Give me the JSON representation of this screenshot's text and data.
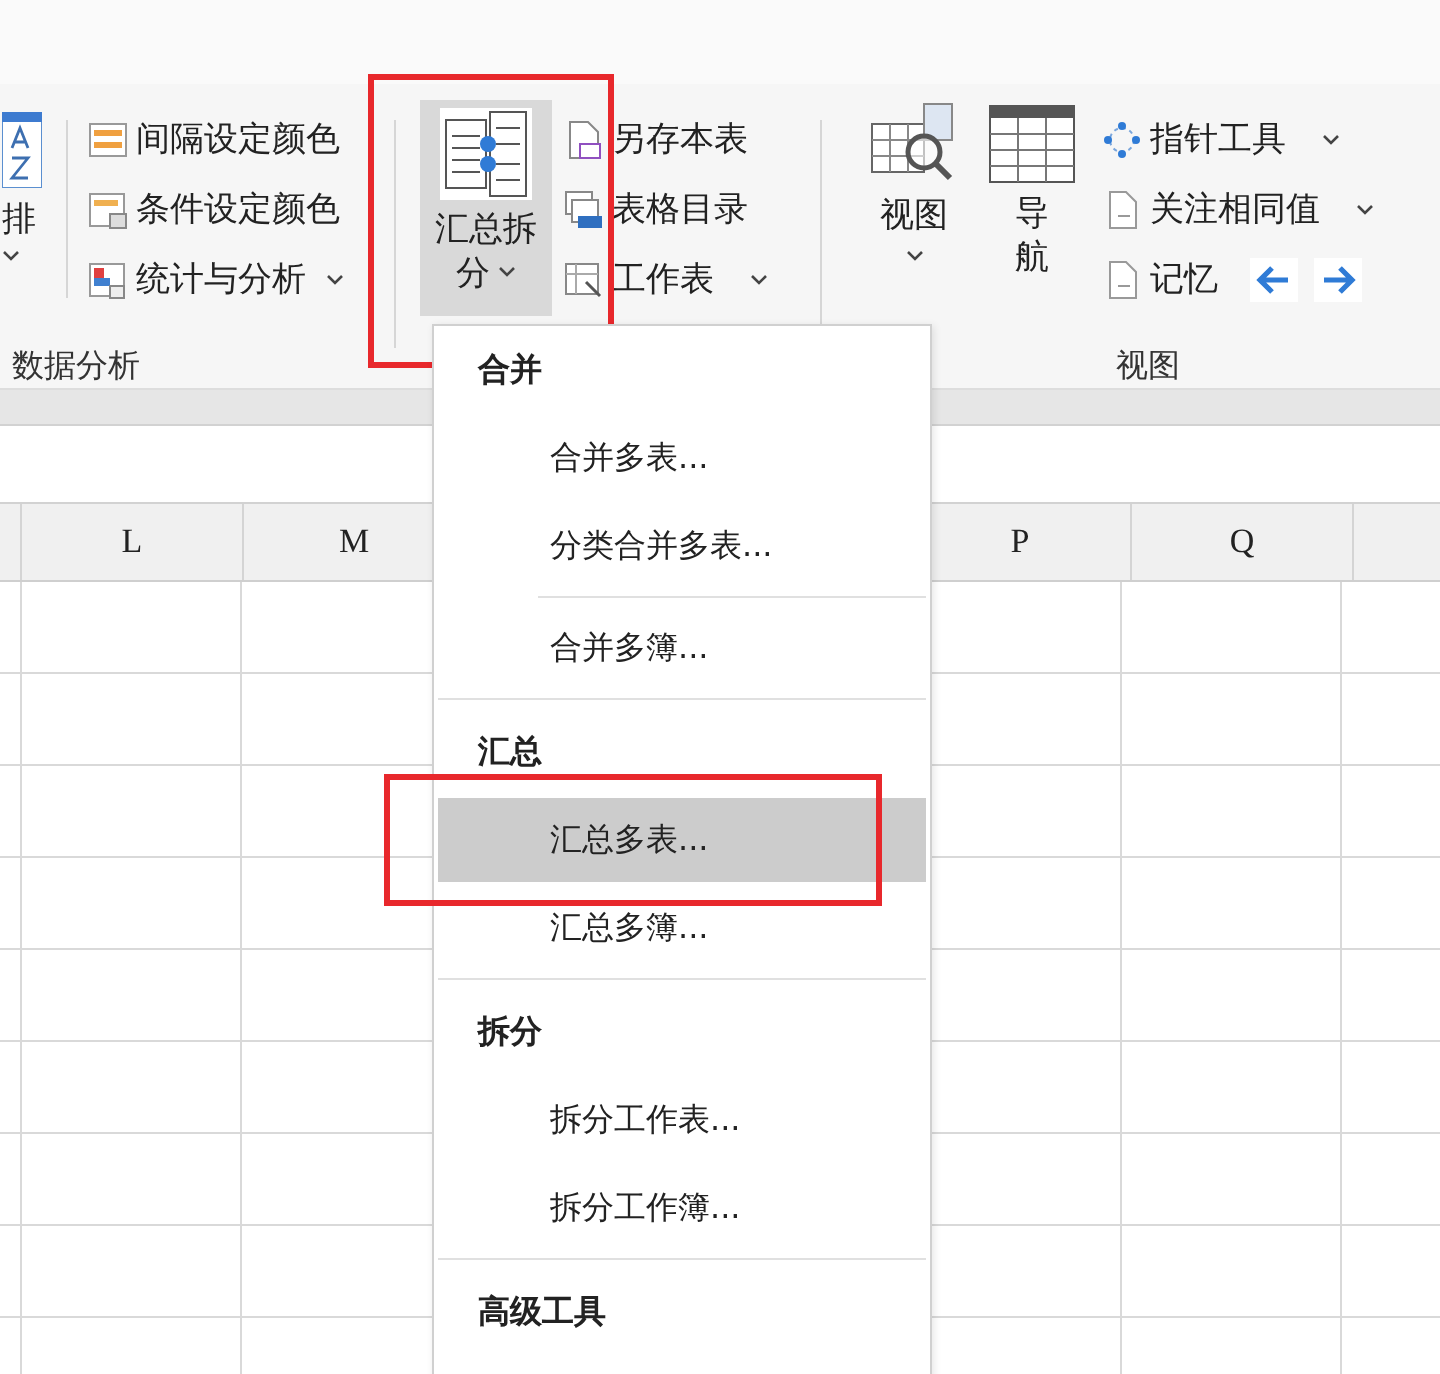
{
  "ribbon": {
    "sort_button": {
      "label": "排",
      "dropdown": true
    },
    "analysis_group": {
      "label": "数据分析",
      "items": [
        {
          "label": "间隔设定颜色",
          "dropdown": false
        },
        {
          "label": "条件设定颜色",
          "dropdown": false
        },
        {
          "label": "统计与分析",
          "dropdown": true
        }
      ]
    },
    "split_group": {
      "big_button": {
        "label": "汇总拆分",
        "pressed": true,
        "highlighted": true,
        "dropdown": true
      },
      "items": [
        {
          "label": "另存本表",
          "dropdown": false
        },
        {
          "label": "表格目录",
          "dropdown": false
        },
        {
          "label": "工作表",
          "dropdown": true
        }
      ]
    },
    "view_group": {
      "label": "视图",
      "view_button": {
        "label": "视图",
        "dropdown": true
      },
      "nav_button": {
        "label": "导航"
      },
      "items": [
        {
          "label": "指针工具",
          "dropdown": true
        },
        {
          "label": "关注相同值",
          "dropdown": true
        },
        {
          "label": "记忆",
          "dropdown": false
        }
      ]
    }
  },
  "columns": [
    {
      "label": "L"
    },
    {
      "label": "M"
    },
    {},
    {},
    {
      "label": "P"
    },
    {
      "label": "Q"
    }
  ],
  "menu": {
    "sections": [
      {
        "title": "合并",
        "items": [
          {
            "label": "合并多表...",
            "selected": false,
            "highlighted": false,
            "separator_before": false
          },
          {
            "label": "分类合并多表...",
            "selected": false,
            "highlighted": false,
            "separator_before": false
          },
          {
            "label": "合并多簿...",
            "selected": false,
            "highlighted": false,
            "separator_before": true
          }
        ]
      },
      {
        "title": "汇总",
        "items": [
          {
            "label": "汇总多表...",
            "selected": true,
            "highlighted": true,
            "separator_before": false
          },
          {
            "label": "汇总多簿...",
            "selected": false,
            "highlighted": false,
            "separator_before": false
          }
        ]
      },
      {
        "title": "拆分",
        "items": [
          {
            "label": "拆分工作表...",
            "selected": false,
            "highlighted": false,
            "separator_before": false
          },
          {
            "label": "拆分工作簿...",
            "selected": false,
            "highlighted": false,
            "separator_before": false
          }
        ]
      },
      {
        "title": "高级工具"
      }
    ]
  }
}
